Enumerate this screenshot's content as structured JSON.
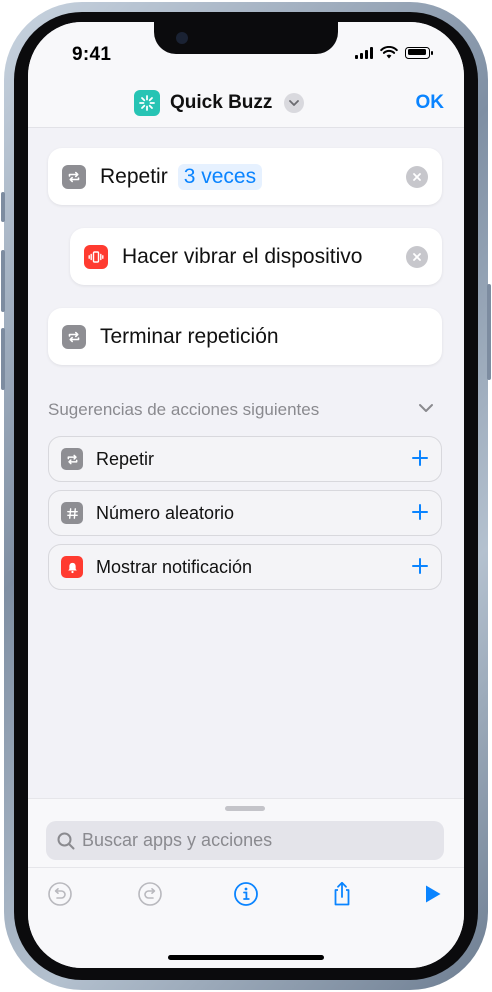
{
  "status_bar": {
    "time": "9:41"
  },
  "header": {
    "title": "Quick Buzz",
    "done_label": "OK"
  },
  "actions": [
    {
      "label": "Repetir",
      "param": "3 veces"
    },
    {
      "label": "Hacer vibrar el dispositivo"
    },
    {
      "label": "Terminar repetición"
    }
  ],
  "suggestions": {
    "title": "Sugerencias de acciones siguientes",
    "items": [
      {
        "label": "Repetir",
        "icon": "repeat-icon"
      },
      {
        "label": "Número aleatorio",
        "icon": "hash-icon"
      },
      {
        "label": "Mostrar notificación",
        "icon": "notification-icon"
      }
    ]
  },
  "search": {
    "placeholder": "Buscar apps y acciones"
  },
  "colors": {
    "accent": "#0a84ff",
    "app_icon": "#27c4b4",
    "gray_icon": "#8e8e93",
    "red_icon": "#ff3b30"
  }
}
